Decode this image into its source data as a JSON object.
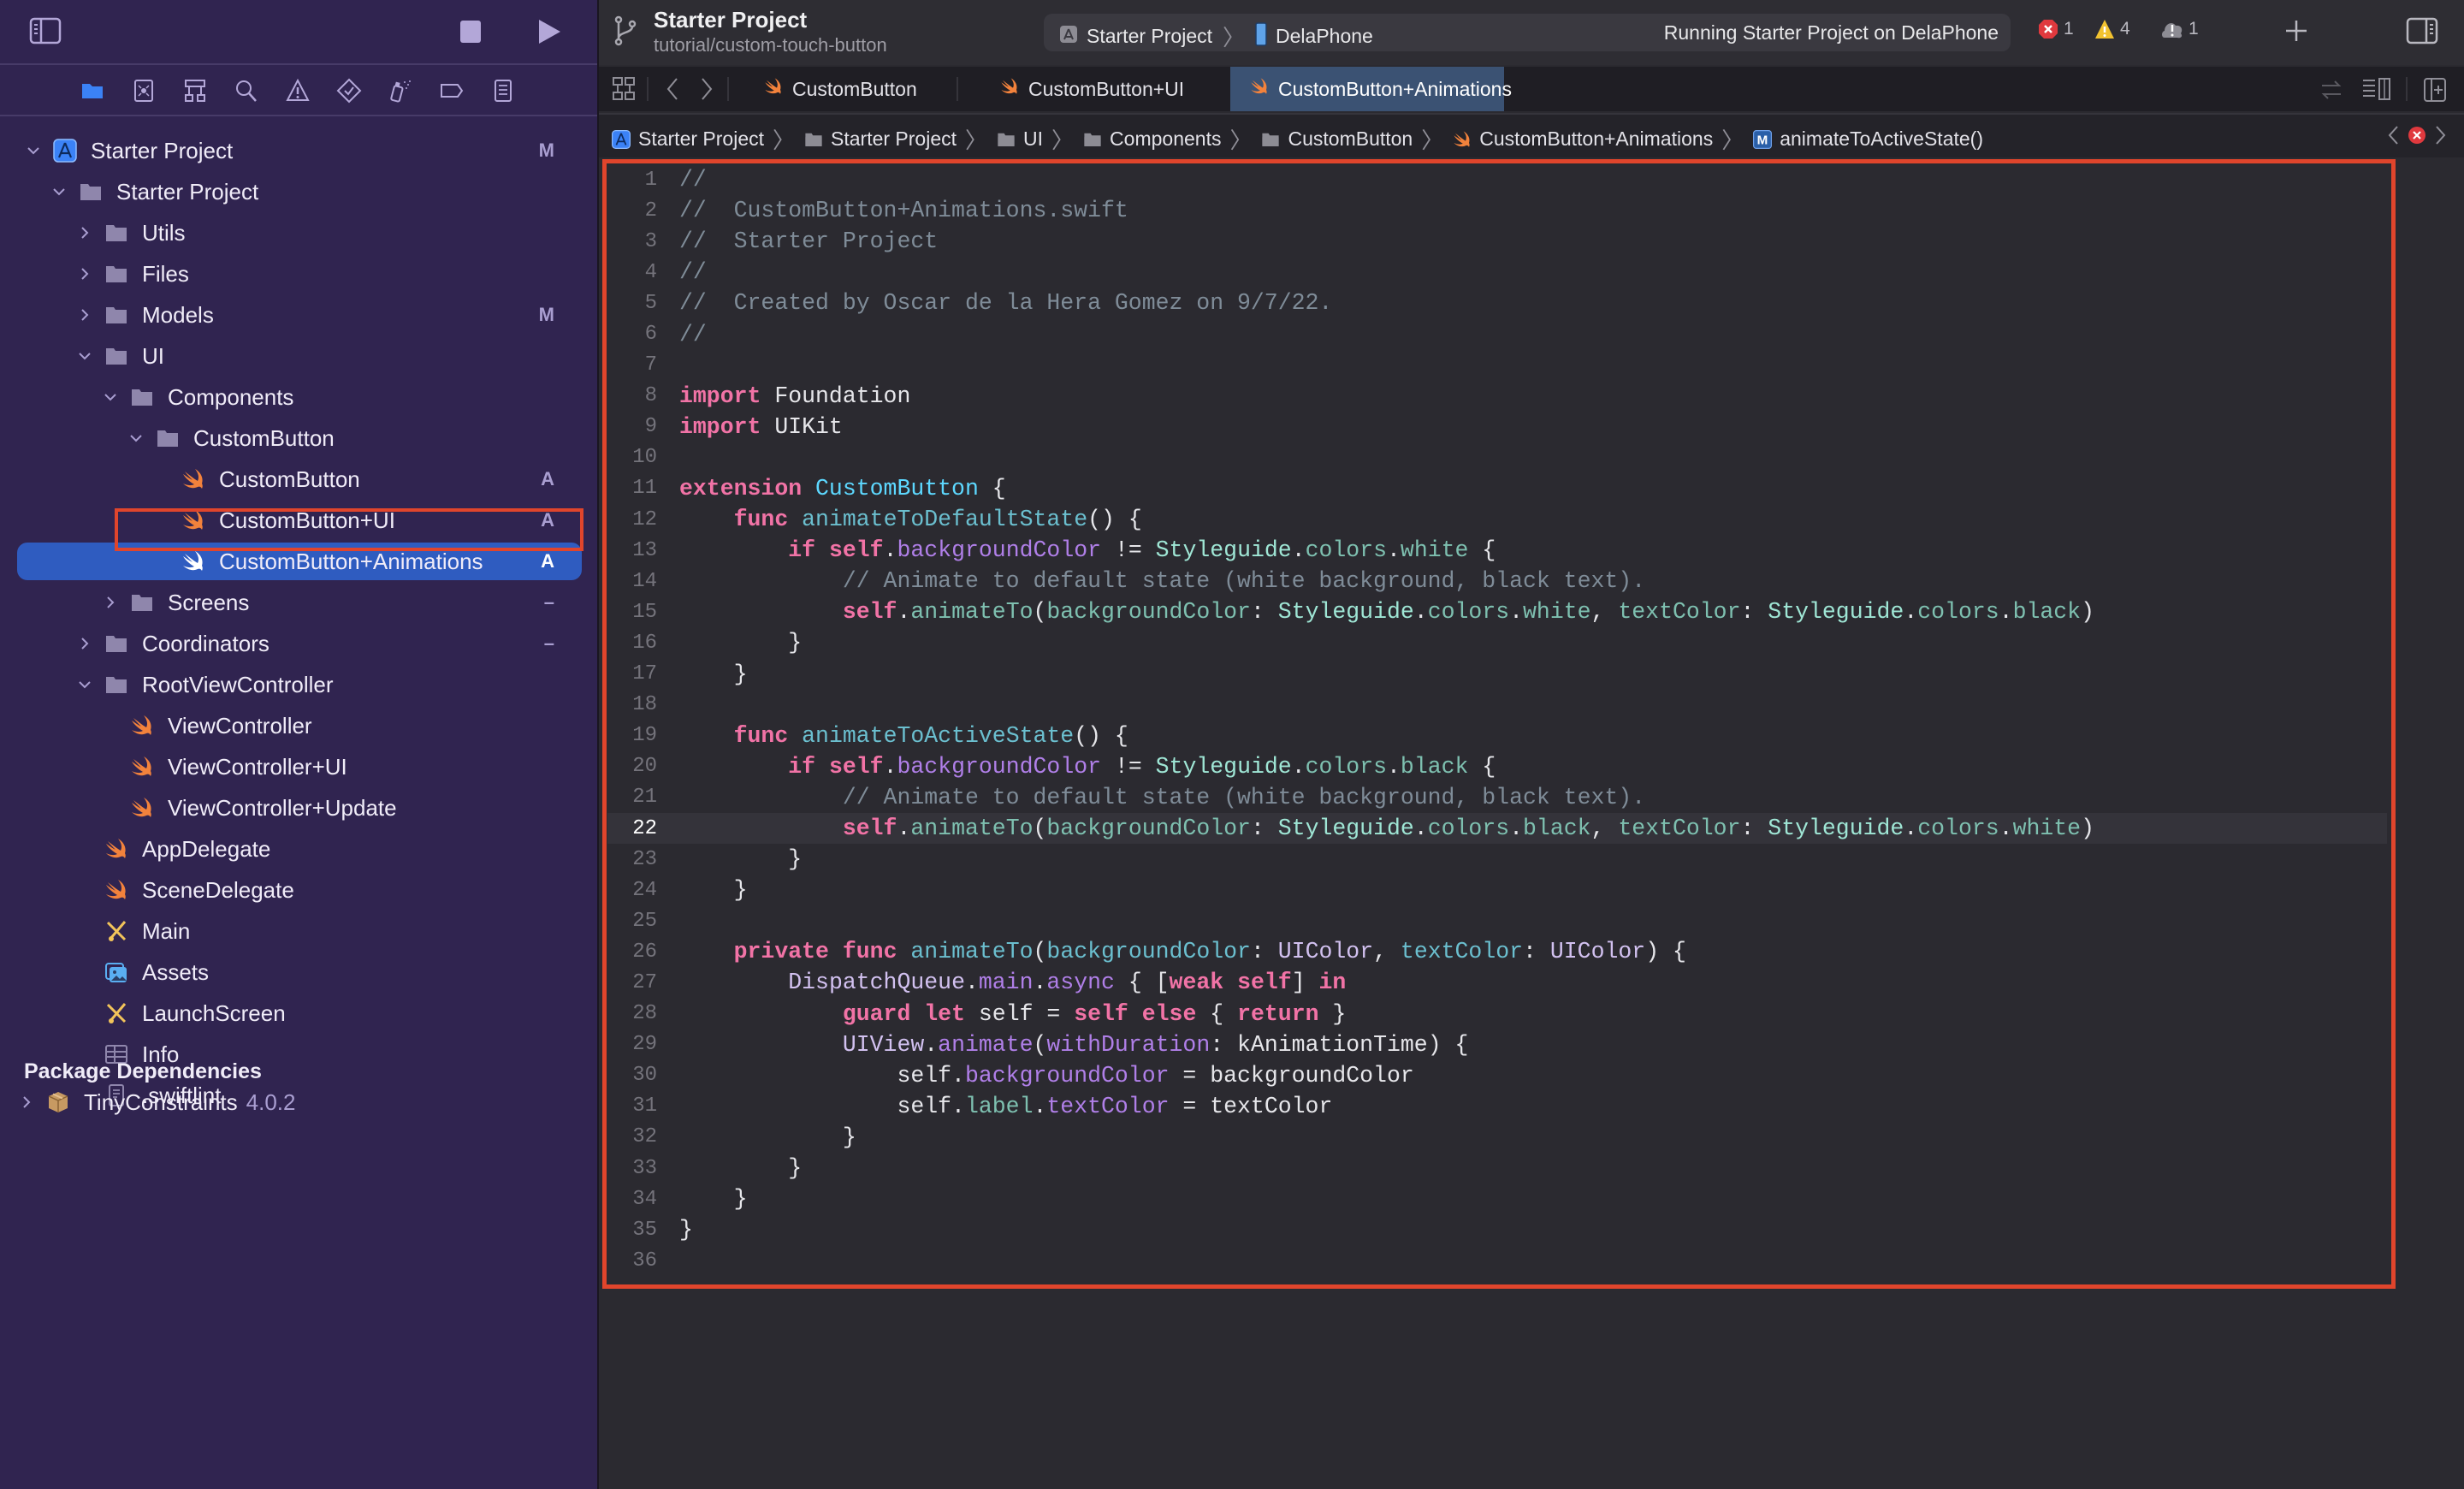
{
  "app": {
    "project_title": "Starter Project",
    "branch": "tutorial/custom-touch-button",
    "scheme": "Starter Project",
    "device": "DelaPhone",
    "status": "Running Starter Project on DelaPhone",
    "issues": {
      "errors": "1",
      "warnings": "4",
      "runtime": "1"
    }
  },
  "colors": {
    "accent": "#2f5cc0",
    "highlight_border": "#e0452c",
    "sidebar_bg": "#302450",
    "editor_bg": "#2b2a30",
    "active_tab": "#3b5273"
  },
  "navigator": {
    "tabs": [
      {
        "name": "project-navigator",
        "icon": "folder-icon",
        "active": true
      },
      {
        "name": "source-control-navigator",
        "icon": "source-control-icon"
      },
      {
        "name": "symbol-navigator",
        "icon": "hierarchy-icon"
      },
      {
        "name": "find-navigator",
        "icon": "search-icon"
      },
      {
        "name": "issue-navigator",
        "icon": "warning-icon"
      },
      {
        "name": "test-navigator",
        "icon": "test-diamond-icon"
      },
      {
        "name": "debug-navigator",
        "icon": "spray-icon"
      },
      {
        "name": "breakpoint-navigator",
        "icon": "breakpoint-icon"
      },
      {
        "name": "report-navigator",
        "icon": "report-icon"
      }
    ],
    "tree": [
      {
        "label": "Starter Project",
        "icon": "xcode-project-icon",
        "depth": 0,
        "chevron": "down",
        "badge": "M"
      },
      {
        "label": "Starter Project",
        "icon": "folder-icon",
        "depth": 1,
        "chevron": "down",
        "badge": ""
      },
      {
        "label": "Utils",
        "icon": "folder-icon",
        "depth": 2,
        "chevron": "right",
        "badge": ""
      },
      {
        "label": "Files",
        "icon": "folder-icon",
        "depth": 2,
        "chevron": "right",
        "badge": ""
      },
      {
        "label": "Models",
        "icon": "folder-icon",
        "depth": 2,
        "chevron": "right",
        "badge": "M"
      },
      {
        "label": "UI",
        "icon": "folder-icon",
        "depth": 2,
        "chevron": "down",
        "badge": ""
      },
      {
        "label": "Components",
        "icon": "folder-icon",
        "depth": 3,
        "chevron": "down",
        "badge": ""
      },
      {
        "label": "CustomButton",
        "icon": "folder-icon",
        "depth": 4,
        "chevron": "down",
        "badge": ""
      },
      {
        "label": "CustomButton",
        "icon": "swift-file-icon",
        "depth": 5,
        "chevron": "",
        "badge": "A"
      },
      {
        "label": "CustomButton+UI",
        "icon": "swift-file-icon",
        "depth": 5,
        "chevron": "",
        "badge": "A"
      },
      {
        "label": "CustomButton+Animations",
        "icon": "swift-file-icon",
        "depth": 5,
        "chevron": "",
        "badge": "A",
        "selected": true
      },
      {
        "label": "Screens",
        "icon": "folder-icon",
        "depth": 3,
        "chevron": "right",
        "badge": "–"
      },
      {
        "label": "Coordinators",
        "icon": "folder-icon",
        "depth": 2,
        "chevron": "right",
        "badge": "–"
      },
      {
        "label": "RootViewController",
        "icon": "folder-icon",
        "depth": 2,
        "chevron": "down",
        "badge": ""
      },
      {
        "label": "ViewController",
        "icon": "swift-file-icon",
        "depth": 3,
        "chevron": "",
        "badge": ""
      },
      {
        "label": "ViewController+UI",
        "icon": "swift-file-icon",
        "depth": 3,
        "chevron": "",
        "badge": ""
      },
      {
        "label": "ViewController+Update",
        "icon": "swift-file-icon",
        "depth": 3,
        "chevron": "",
        "badge": ""
      },
      {
        "label": "AppDelegate",
        "icon": "swift-file-icon",
        "depth": 2,
        "chevron": "",
        "badge": ""
      },
      {
        "label": "SceneDelegate",
        "icon": "swift-file-icon",
        "depth": 2,
        "chevron": "",
        "badge": ""
      },
      {
        "label": "Main",
        "icon": "storyboard-icon",
        "depth": 2,
        "chevron": "",
        "badge": ""
      },
      {
        "label": "Assets",
        "icon": "asset-catalog-icon",
        "depth": 2,
        "chevron": "",
        "badge": ""
      },
      {
        "label": "LaunchScreen",
        "icon": "storyboard-icon",
        "depth": 2,
        "chevron": "",
        "badge": ""
      },
      {
        "label": "Info",
        "icon": "plist-icon",
        "depth": 2,
        "chevron": "",
        "badge": ""
      },
      {
        "label": ".swiftlint",
        "icon": "text-file-icon",
        "depth": 2,
        "chevron": "",
        "badge": ""
      }
    ],
    "package_section_title": "Package Dependencies",
    "packages": [
      {
        "label": "TinyConstraints",
        "version": "4.0.2",
        "icon": "package-icon"
      }
    ]
  },
  "editor": {
    "tabs": [
      {
        "label": "CustomButton",
        "active": false
      },
      {
        "label": "CustomButton+UI",
        "active": false
      },
      {
        "label": "CustomButton+Animations",
        "active": true
      }
    ],
    "breadcrumbs": [
      {
        "label": "Starter Project",
        "icon": "xcode-project-icon"
      },
      {
        "label": "Starter Project",
        "icon": "folder-icon"
      },
      {
        "label": "UI",
        "icon": "folder-icon"
      },
      {
        "label": "Components",
        "icon": "folder-icon"
      },
      {
        "label": "CustomButton",
        "icon": "folder-icon"
      },
      {
        "label": "CustomButton+Animations",
        "icon": "swift-file-icon"
      },
      {
        "label": "animateToActiveState()",
        "icon": "method-icon"
      }
    ],
    "current_line": 22,
    "lines": [
      [
        [
          "cm",
          "//"
        ]
      ],
      [
        [
          "cm",
          "//  CustomButton+Animations.swift"
        ]
      ],
      [
        [
          "cm",
          "//  Starter Project"
        ]
      ],
      [
        [
          "cm",
          "//"
        ]
      ],
      [
        [
          "cm",
          "//  Created by Oscar de la Hera Gomez on 9/7/22."
        ]
      ],
      [
        [
          "cm",
          "//"
        ]
      ],
      [],
      [
        [
          "kw",
          "import"
        ],
        [
          "plain",
          " Foundation"
        ]
      ],
      [
        [
          "kw",
          "import"
        ],
        [
          "plain",
          " UIKit"
        ]
      ],
      [],
      [
        [
          "kw",
          "extension"
        ],
        [
          "plain",
          " "
        ],
        [
          "decl",
          "CustomButton"
        ],
        [
          "plain",
          " {"
        ]
      ],
      [
        [
          "plain",
          "    "
        ],
        [
          "kw",
          "func"
        ],
        [
          "plain",
          " "
        ],
        [
          "func",
          "animateToDefaultState"
        ],
        [
          "plain",
          "() {"
        ]
      ],
      [
        [
          "plain",
          "        "
        ],
        [
          "kw",
          "if"
        ],
        [
          "plain",
          " "
        ],
        [
          "kw",
          "self"
        ],
        [
          "plain",
          "."
        ],
        [
          "prop",
          "backgroundColor"
        ],
        [
          "plain",
          " != "
        ],
        [
          "type",
          "Styleguide"
        ],
        [
          "plain",
          "."
        ],
        [
          "other",
          "colors"
        ],
        [
          "plain",
          "."
        ],
        [
          "other",
          "white"
        ],
        [
          "plain",
          " {"
        ]
      ],
      [
        [
          "plain",
          "            "
        ],
        [
          "cm",
          "// Animate to default state (white background, black text)."
        ]
      ],
      [
        [
          "plain",
          "            "
        ],
        [
          "kw",
          "self"
        ],
        [
          "plain",
          "."
        ],
        [
          "other",
          "animateTo"
        ],
        [
          "plain",
          "("
        ],
        [
          "other",
          "backgroundColor"
        ],
        [
          "plain",
          ": "
        ],
        [
          "type",
          "Styleguide"
        ],
        [
          "plain",
          "."
        ],
        [
          "other",
          "colors"
        ],
        [
          "plain",
          "."
        ],
        [
          "other",
          "white"
        ],
        [
          "plain",
          ", "
        ],
        [
          "other",
          "textColor"
        ],
        [
          "plain",
          ": "
        ],
        [
          "type",
          "Styleguide"
        ],
        [
          "plain",
          "."
        ],
        [
          "other",
          "colors"
        ],
        [
          "plain",
          "."
        ],
        [
          "other",
          "black"
        ],
        [
          "plain",
          ")"
        ]
      ],
      [
        [
          "plain",
          "        }"
        ]
      ],
      [
        [
          "plain",
          "    }"
        ]
      ],
      [],
      [
        [
          "plain",
          "    "
        ],
        [
          "kw",
          "func"
        ],
        [
          "plain",
          " "
        ],
        [
          "func",
          "animateToActiveState"
        ],
        [
          "plain",
          "() {"
        ]
      ],
      [
        [
          "plain",
          "        "
        ],
        [
          "kw",
          "if"
        ],
        [
          "plain",
          " "
        ],
        [
          "kw",
          "self"
        ],
        [
          "plain",
          "."
        ],
        [
          "prop",
          "backgroundColor"
        ],
        [
          "plain",
          " != "
        ],
        [
          "type",
          "Styleguide"
        ],
        [
          "plain",
          "."
        ],
        [
          "other",
          "colors"
        ],
        [
          "plain",
          "."
        ],
        [
          "other",
          "black"
        ],
        [
          "plain",
          " {"
        ]
      ],
      [
        [
          "plain",
          "            "
        ],
        [
          "cm",
          "// Animate to default state (white background, black text)."
        ]
      ],
      [
        [
          "plain",
          "            "
        ],
        [
          "kw",
          "self"
        ],
        [
          "plain",
          "."
        ],
        [
          "other",
          "animateTo"
        ],
        [
          "plain",
          "("
        ],
        [
          "other",
          "backgroundColor"
        ],
        [
          "plain",
          ": "
        ],
        [
          "type",
          "Styleguide"
        ],
        [
          "plain",
          "."
        ],
        [
          "other",
          "colors"
        ],
        [
          "plain",
          "."
        ],
        [
          "other",
          "black"
        ],
        [
          "plain",
          ", "
        ],
        [
          "other",
          "textColor"
        ],
        [
          "plain",
          ": "
        ],
        [
          "type",
          "Styleguide"
        ],
        [
          "plain",
          "."
        ],
        [
          "other",
          "colors"
        ],
        [
          "plain",
          "."
        ],
        [
          "other",
          "white"
        ],
        [
          "plain",
          ")"
        ]
      ],
      [
        [
          "plain",
          "        }"
        ]
      ],
      [
        [
          "plain",
          "    }"
        ]
      ],
      [],
      [
        [
          "plain",
          "    "
        ],
        [
          "kw",
          "private"
        ],
        [
          "plain",
          " "
        ],
        [
          "kw",
          "func"
        ],
        [
          "plain",
          " "
        ],
        [
          "func",
          "animateTo"
        ],
        [
          "plain",
          "("
        ],
        [
          "func",
          "backgroundColor"
        ],
        [
          "plain",
          ": "
        ],
        [
          "lib",
          "UIColor"
        ],
        [
          "plain",
          ", "
        ],
        [
          "func",
          "textColor"
        ],
        [
          "plain",
          ": "
        ],
        [
          "lib",
          "UIColor"
        ],
        [
          "plain",
          ") {"
        ]
      ],
      [
        [
          "plain",
          "        "
        ],
        [
          "lib",
          "DispatchQueue"
        ],
        [
          "plain",
          "."
        ],
        [
          "prop",
          "main"
        ],
        [
          "plain",
          "."
        ],
        [
          "prop",
          "async"
        ],
        [
          "plain",
          " { ["
        ],
        [
          "kw",
          "weak"
        ],
        [
          "plain",
          " "
        ],
        [
          "kw",
          "self"
        ],
        [
          "plain",
          "] "
        ],
        [
          "kw",
          "in"
        ]
      ],
      [
        [
          "plain",
          "            "
        ],
        [
          "kw",
          "guard"
        ],
        [
          "plain",
          " "
        ],
        [
          "kw",
          "let"
        ],
        [
          "plain",
          " self = "
        ],
        [
          "kw",
          "self"
        ],
        [
          "plain",
          " "
        ],
        [
          "kw",
          "else"
        ],
        [
          "plain",
          " { "
        ],
        [
          "kw",
          "return"
        ],
        [
          "plain",
          " }"
        ]
      ],
      [
        [
          "plain",
          "            "
        ],
        [
          "lib",
          "UIView"
        ],
        [
          "plain",
          "."
        ],
        [
          "prop",
          "animate"
        ],
        [
          "plain",
          "("
        ],
        [
          "prop",
          "withDuration"
        ],
        [
          "plain",
          ": kAnimationTime) {"
        ]
      ],
      [
        [
          "plain",
          "                self."
        ],
        [
          "prop",
          "backgroundColor"
        ],
        [
          "plain",
          " = backgroundColor"
        ]
      ],
      [
        [
          "plain",
          "                self."
        ],
        [
          "other",
          "label"
        ],
        [
          "plain",
          "."
        ],
        [
          "prop",
          "textColor"
        ],
        [
          "plain",
          " = textColor"
        ]
      ],
      [
        [
          "plain",
          "            }"
        ]
      ],
      [
        [
          "plain",
          "        }"
        ]
      ],
      [
        [
          "plain",
          "    }"
        ]
      ],
      [
        [
          "plain",
          "}"
        ]
      ],
      []
    ]
  }
}
